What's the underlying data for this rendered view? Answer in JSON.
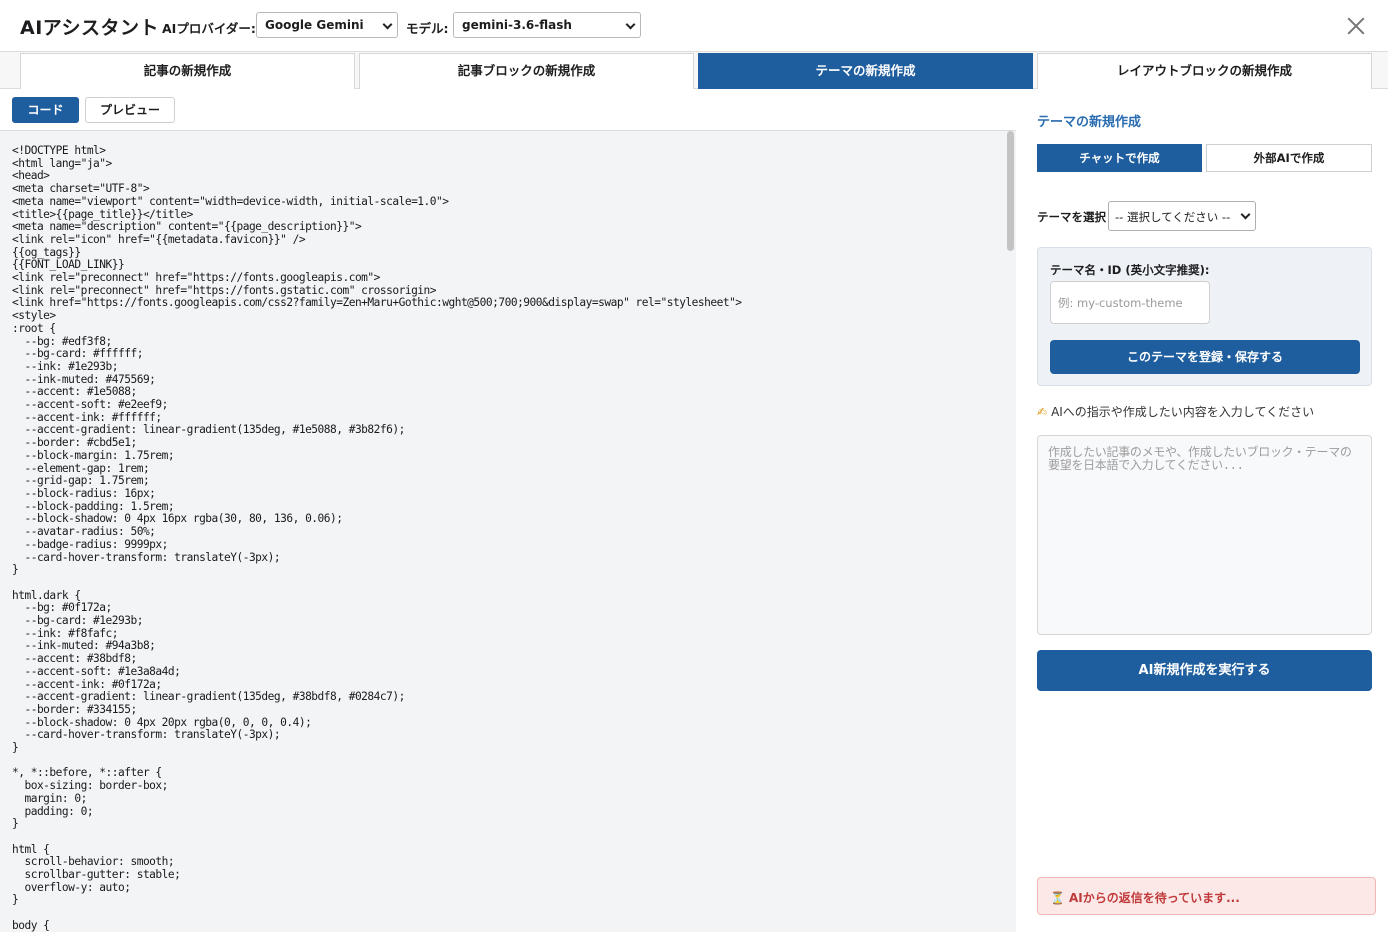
{
  "header": {
    "title": "AIアシスタント",
    "provider_label": "AIプロバイダー:",
    "provider_value": "Google Gemini",
    "model_label": "モデル:",
    "model_value": "gemini-3.6-flash"
  },
  "tabs": [
    {
      "label": "記事の新規作成"
    },
    {
      "label": "記事ブロックの新規作成"
    },
    {
      "label": "テーマの新規作成"
    },
    {
      "label": "レイアウトブロックの新規作成"
    }
  ],
  "view_toggle": {
    "code": "コード",
    "preview": "プレビュー"
  },
  "code": "<!DOCTYPE html>\n<html lang=\"ja\">\n<head>\n<meta charset=\"UTF-8\">\n<meta name=\"viewport\" content=\"width=device-width, initial-scale=1.0\">\n<title>{{page_title}}</title>\n<meta name=\"description\" content=\"{{page_description}}\">\n<link rel=\"icon\" href=\"{{metadata.favicon}}\" />\n{{og_tags}}\n{{FONT_LOAD_LINK}}\n<link rel=\"preconnect\" href=\"https://fonts.googleapis.com\">\n<link rel=\"preconnect\" href=\"https://fonts.gstatic.com\" crossorigin>\n<link href=\"https://fonts.googleapis.com/css2?family=Zen+Maru+Gothic:wght@500;700;900&display=swap\" rel=\"stylesheet\">\n<style>\n:root {\n  --bg: #edf3f8;\n  --bg-card: #ffffff;\n  --ink: #1e293b;\n  --ink-muted: #475569;\n  --accent: #1e5088;\n  --accent-soft: #e2eef9;\n  --accent-ink: #ffffff;\n  --accent-gradient: linear-gradient(135deg, #1e5088, #3b82f6);\n  --border: #cbd5e1;\n  --block-margin: 1.75rem;\n  --element-gap: 1rem;\n  --grid-gap: 1.75rem;\n  --block-radius: 16px;\n  --block-padding: 1.5rem;\n  --block-shadow: 0 4px 16px rgba(30, 80, 136, 0.06);\n  --avatar-radius: 50%;\n  --badge-radius: 9999px;\n  --card-hover-transform: translateY(-3px);\n}\n\nhtml.dark {\n  --bg: #0f172a;\n  --bg-card: #1e293b;\n  --ink: #f8fafc;\n  --ink-muted: #94a3b8;\n  --accent: #38bdf8;\n  --accent-soft: #1e3a8a4d;\n  --accent-ink: #0f172a;\n  --accent-gradient: linear-gradient(135deg, #38bdf8, #0284c7);\n  --border: #334155;\n  --block-shadow: 0 4px 20px rgba(0, 0, 0, 0.4);\n  --card-hover-transform: translateY(-3px);\n}\n\n*, *::before, *::after {\n  box-sizing: border-box;\n  margin: 0;\n  padding: 0;\n}\n\nhtml {\n  scroll-behavior: smooth;\n  scrollbar-gutter: stable;\n  overflow-y: auto;\n}\n\nbody {",
  "panel": {
    "title": "テーマの新規作成",
    "subtabs": [
      {
        "label": "チャットで作成"
      },
      {
        "label": "外部AIで作成"
      }
    ],
    "theme_select_label": "テーマを選択",
    "theme_select_value": "-- 選択してください --",
    "theme_id_label": "テーマ名・ID (英小文字推奨):",
    "theme_id_placeholder": "例: my-custom-theme",
    "save_label": "このテーマを登録・保存する",
    "hint": "AIへの指示や作成したい内容を入力してください",
    "prompt_placeholder": "作成したい記事のメモや、作成したいブロック・テーマの要望を日本語で入力してください...",
    "run_label": "AI新規作成を実行する",
    "status": "AIからの返信を待っています..."
  },
  "colors": {
    "accent": "#1e5e9e",
    "status_bg": "#fde8e8",
    "status_text": "#c03a3a"
  }
}
